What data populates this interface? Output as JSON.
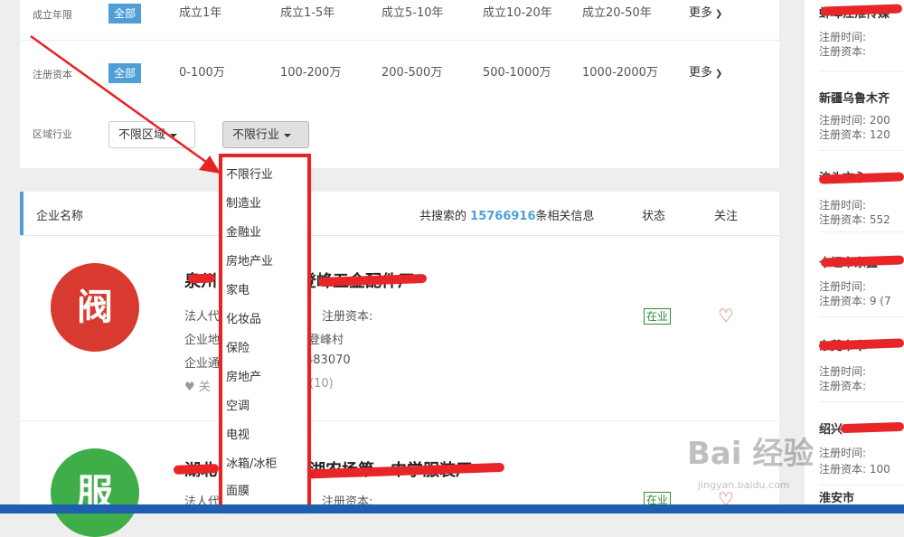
{
  "filters": {
    "founded": {
      "label": "成立年限",
      "all": "全部",
      "options": [
        "成立1年",
        "成立1-5年",
        "成立5-10年",
        "成立10-20年",
        "成立20-50年"
      ],
      "more": "更多"
    },
    "capital": {
      "label": "注册资本",
      "all": "全部",
      "options": [
        "0-100万",
        "100-200万",
        "200-500万",
        "500-1000万",
        "1000-2000万"
      ],
      "more": "更多"
    },
    "region": {
      "label": "区域行业",
      "region_select": "不限区域",
      "industry_select": "不限行业"
    }
  },
  "industry_dropdown": {
    "items": [
      "不限行业",
      "制造业",
      "金融业",
      "房地产业",
      "家电",
      "化妆品",
      "保险",
      "房地产",
      "空调",
      "电视",
      "冰箱/冰柜",
      "面膜"
    ]
  },
  "list": {
    "header": {
      "name_col": "企业名称",
      "search_prefix": "共搜索的",
      "count": "15766916",
      "search_suffix": "条相关信息",
      "status_col": "状态",
      "follow_col": "关注"
    },
    "rows": [
      {
        "name_start": "泉州",
        "name_end": "登峰五金配件厂",
        "legal_label": "法人代",
        "capital_label": "注册资本:",
        "addr_label": "企业地",
        "addr_value": "西登峰村",
        "phone_label": "企业通",
        "phone_value": "483070",
        "follow_prefix": "关",
        "follow_count": "(10)",
        "status": "在业",
        "logo_color": "#d93a30",
        "logo_glyph": "阀"
      },
      {
        "name_start": "湖北",
        "name_end": "潜湖农场第一中学服装厂",
        "legal_label": "法人代",
        "capital_label": "注册资本:",
        "status": "在业",
        "logo_color": "#3fae49",
        "logo_glyph": "服"
      }
    ]
  },
  "sidebar": {
    "items": [
      {
        "title": "蚌埠江淮传媒",
        "reg_time": "注册时间:",
        "reg_capital": "注册资本:"
      },
      {
        "title": "新疆乌鲁木齐",
        "reg_time": "注册时间: 200",
        "reg_capital": "注册资本: 120"
      },
      {
        "title": "泊头市永",
        "reg_time": "注册时间:",
        "reg_capital": "注册资本: 552"
      },
      {
        "title": "十堰市东鑫",
        "reg_time": "注册时间:",
        "reg_capital": "注册资本: 9 (7"
      },
      {
        "title": "东莞市卓",
        "reg_time": "注册时间:",
        "reg_capital": "注册资本:"
      },
      {
        "title": "绍兴",
        "reg_time": "注册时间:",
        "reg_capital": "注册资本: 100"
      },
      {
        "title": "淮安市"
      }
    ]
  },
  "watermark": {
    "main": "Bai 经验",
    "sub": "jingyan.baidu.com"
  },
  "colors": {
    "accent": "#4f9fd6",
    "annotation": "#e82222",
    "status": "#2e8b3a"
  }
}
